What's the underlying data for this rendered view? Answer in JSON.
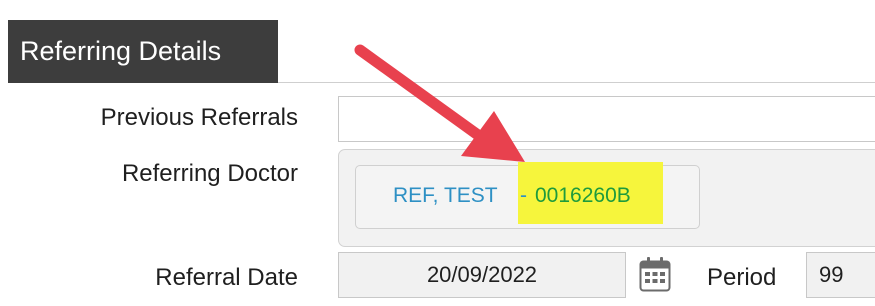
{
  "panel": {
    "title": "Referring Details"
  },
  "fields": {
    "previous_referrals": {
      "label": "Previous Referrals",
      "value": ""
    },
    "referring_doctor": {
      "label": "Referring Doctor",
      "name": "REF, TEST",
      "separator": "-",
      "code": "0016260B"
    },
    "referral_date": {
      "label": "Referral Date",
      "value": "20/09/2022"
    },
    "period": {
      "label": "Period",
      "value": "99"
    }
  },
  "icons": {
    "calendar": "calendar-icon",
    "annotation": "arrow-annotation"
  },
  "colors": {
    "header_bg": "#3d3d3d",
    "doctor_name": "#2e90c4",
    "doctor_code": "#1e9b3c",
    "highlight": "#f6f53c",
    "arrow": "#e8414e"
  }
}
